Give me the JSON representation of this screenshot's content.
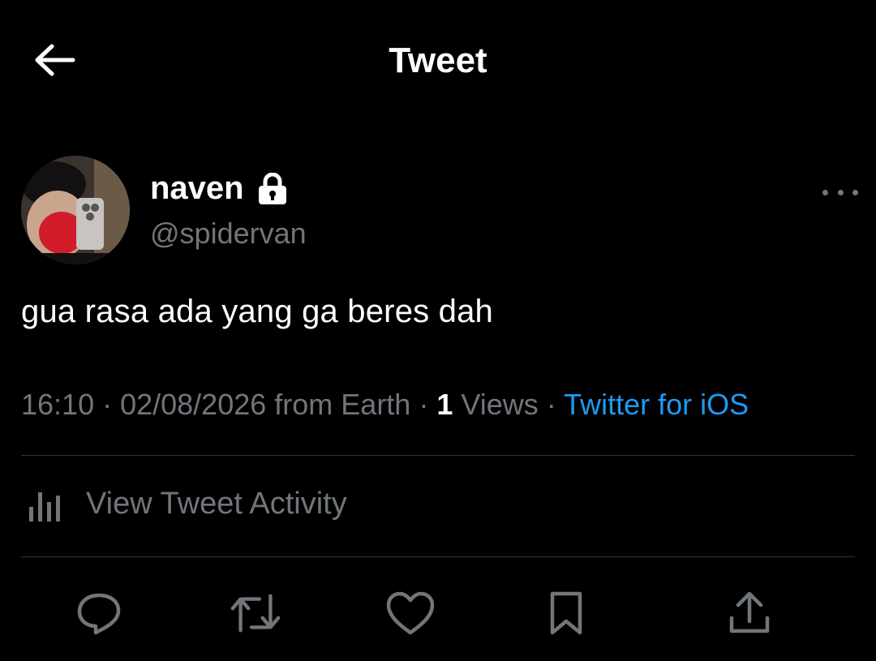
{
  "header": {
    "title": "Tweet",
    "back_icon": "arrow-left-icon"
  },
  "author": {
    "display_name": "naven",
    "handle": "@spidervan",
    "protected_icon": "lock-icon",
    "more_icon": "more-horizontal-icon"
  },
  "tweet": {
    "text": "gua rasa ada yang ga beres dah"
  },
  "meta": {
    "time": "16:10",
    "sep1": " · ",
    "date": "02/08/2026",
    "location": " from Earth",
    "sep2": " · ",
    "views_count": "1",
    "views_label": " Views",
    "sep3": " · ",
    "source": "Twitter for iOS"
  },
  "activity": {
    "label": "View Tweet Activity",
    "icon": "bar-chart-icon"
  },
  "actions": [
    "reply-icon",
    "retweet-icon",
    "like-icon",
    "bookmark-icon",
    "share-icon"
  ],
  "colors": {
    "background": "#000000",
    "text": "#ffffff",
    "secondary": "#71767b",
    "link": "#1d9bf0",
    "divider": "#2f3336"
  }
}
